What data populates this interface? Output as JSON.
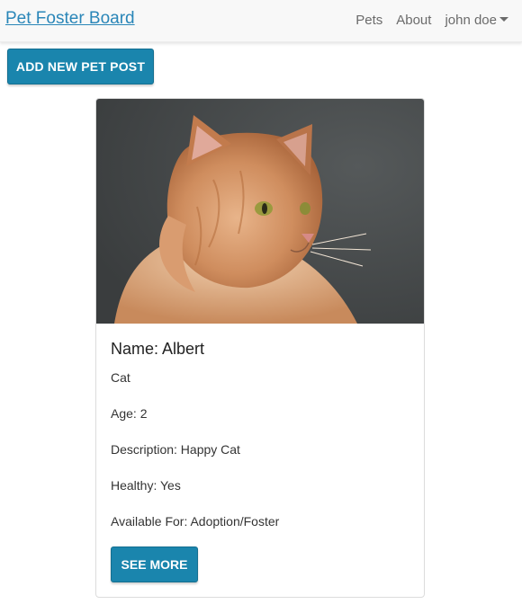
{
  "navbar": {
    "brand": "Pet Foster Board",
    "links": [
      "Pets",
      "About"
    ],
    "user_menu": "john doe",
    "user_menu_icon": "caret-down-icon"
  },
  "actions": {
    "add_post_label": "ADD NEW PET POST"
  },
  "pet_card": {
    "image_alt": "orange long-haired cat photo",
    "name": "Name: Albert",
    "species": "Cat",
    "age": "Age: 2",
    "description": "Description: Happy Cat",
    "healthy": "Healthy: Yes",
    "available_for": "Available For: Adoption/Foster",
    "see_more_label": "SEE MORE"
  },
  "colors": {
    "brand_link": "#2a86b8",
    "button": "#1a85ad",
    "navbar_bg": "#f8f8f8"
  }
}
